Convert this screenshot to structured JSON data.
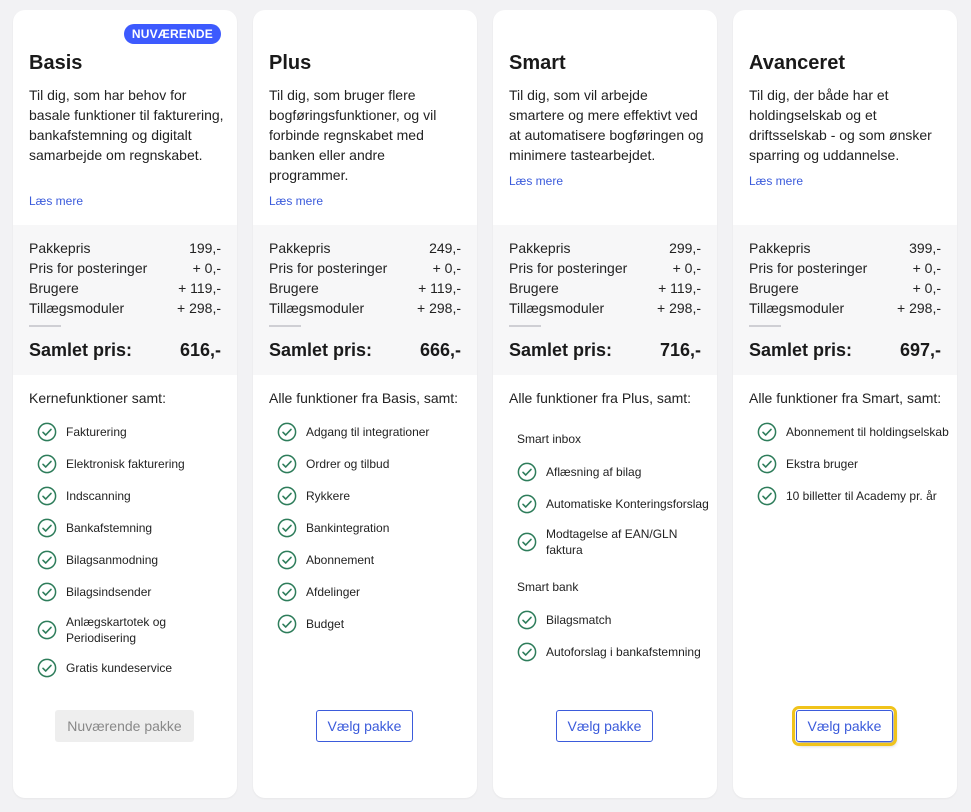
{
  "colors": {
    "accent": "#3d5afe",
    "link": "#3b5bdb",
    "check": "#2e7d5b",
    "highlight": "#f0c31b"
  },
  "icons": {
    "feature_check": "check-circle-icon"
  },
  "price_labels": {
    "package": "Pakkepris",
    "postings": "Pris for posteringer",
    "users": "Brugere",
    "addons": "Tillægsmoduler",
    "total": "Samlet pris:"
  },
  "plans": [
    {
      "badge": "NUVÆRENDE",
      "title": "Basis",
      "description": "Til dig, som har behov for basale funktioner til fakturering, bankafstemning og digitalt samarbejde om regnskabet.",
      "read_more": "Læs mere",
      "prices": {
        "package": "199,-",
        "postings": "+ 0,-",
        "users": "+ 119,-",
        "addons": "+ 298,-",
        "total": "616,-"
      },
      "features_heading": "Kernefunktioner samt:",
      "features": [
        "Fakturering",
        "Elektronisk fakturering",
        "Indscanning",
        "Bankafstemning",
        "Bilagsanmodning",
        "Bilagsindsender",
        "Anlægskartotek og Periodisering",
        "Gratis kundeservice"
      ],
      "button": "Nuværende pakke"
    },
    {
      "title": "Plus",
      "description": "Til dig, som bruger flere bogføringsfunktioner, og vil forbinde regnskabet med banken eller andre programmer.",
      "read_more": "Læs mere",
      "prices": {
        "package": "249,-",
        "postings": "+ 0,-",
        "users": "+ 119,-",
        "addons": "+ 298,-",
        "total": "666,-"
      },
      "features_heading": "Alle funktioner fra Basis, samt:",
      "features": [
        "Adgang til integrationer",
        "Ordrer og tilbud",
        "Rykkere",
        "Bankintegration",
        "Abonnement",
        "Afdelinger",
        "Budget"
      ],
      "button": "Vælg pakke"
    },
    {
      "title": "Smart",
      "description": "Til dig, som vil arbejde smartere og mere effektivt ved at automatisere bogføringen og minimere tastearbejdet.",
      "read_more": "Læs mere",
      "prices": {
        "package": "299,-",
        "postings": "+ 0,-",
        "users": "+ 119,-",
        "addons": "+ 298,-",
        "total": "716,-"
      },
      "features_heading": "Alle funktioner fra Plus, samt:",
      "groups": [
        {
          "name": "Smart inbox",
          "features": [
            "Aflæsning af bilag",
            "Automatiske Konteringsforslag",
            "Modtagelse af EAN/GLN faktura"
          ]
        },
        {
          "name": "Smart bank",
          "features": [
            "Bilagsmatch",
            "Autoforslag i bankafstemning"
          ]
        }
      ],
      "button": "Vælg pakke"
    },
    {
      "title": "Avanceret",
      "description": "Til dig, der både har et holdingselskab og et driftsselskab - og som ønsker sparring og uddannelse.",
      "read_more": "Læs mere",
      "prices": {
        "package": "399,-",
        "postings": "+ 0,-",
        "users": "+ 0,-",
        "addons": "+ 298,-",
        "total": "697,-"
      },
      "features_heading": "Alle funktioner fra Smart, samt:",
      "features": [
        "Abonnement til holdingselskab",
        "Ekstra bruger",
        "10 billetter til Academy pr. år"
      ],
      "button": "Vælg pakke"
    }
  ]
}
